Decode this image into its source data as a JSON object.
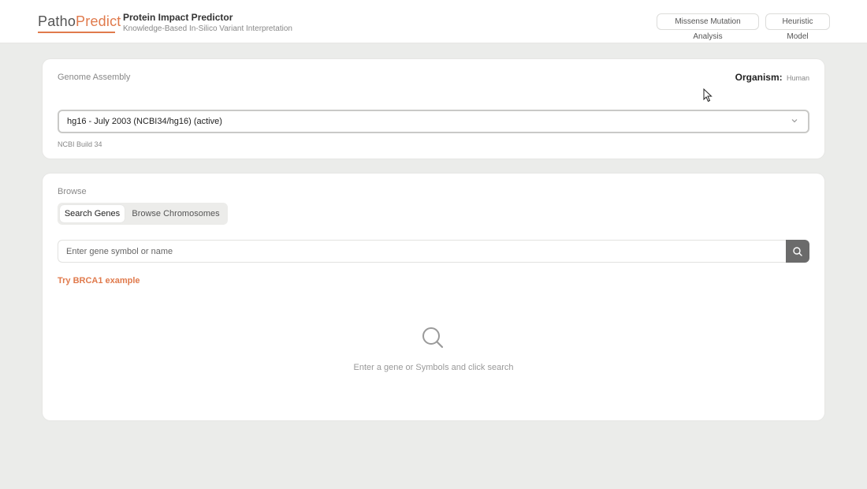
{
  "header": {
    "logo_part1": "Patho",
    "logo_part2": "Predict",
    "title": "Protein Impact Predictor",
    "subtitle": "Knowledge-Based In-Silico Variant Interpretation",
    "buttons": [
      "Missense Mutation Analysis",
      "Heuristic Model"
    ]
  },
  "assembly": {
    "label": "Genome Assembly",
    "organism_label": "Organism:",
    "organism_value": "Human",
    "selected": "hg16 - July 2003 (NCBI34/hg16) (active)",
    "build_note": "NCBI Build 34"
  },
  "browse": {
    "label": "Browse",
    "tabs": [
      "Search Genes",
      "Browse Chromosomes"
    ],
    "active_tab": "Search Genes",
    "search_placeholder": "Enter gene symbol or name",
    "search_value": "",
    "example_link": "Try BRCA1 example",
    "empty_message": "Enter a gene or Symbols and click search"
  },
  "colors": {
    "accent": "#e07a4c",
    "background": "#ebecea",
    "search_button": "#6b6b6b"
  },
  "icons": [
    "search-icon",
    "chevron-down-icon",
    "mouse-cursor-icon"
  ]
}
